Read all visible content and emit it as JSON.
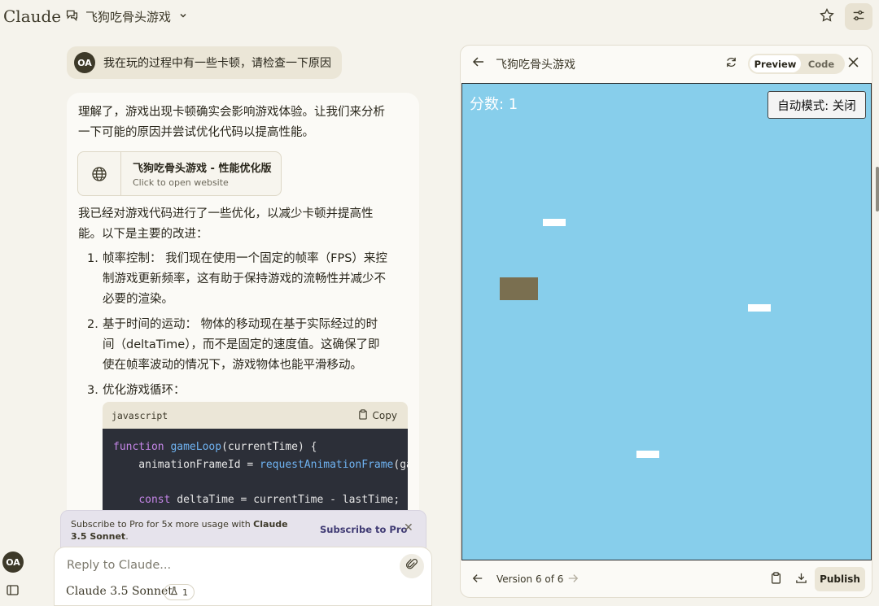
{
  "app": {
    "brand": "Claude"
  },
  "header": {
    "chat_title": "飞狗吃骨头游戏"
  },
  "user_message": {
    "avatar": "OA",
    "text": "我在玩的过程中有一些卡顿，请检查一下原因"
  },
  "assistant": {
    "intro": "理解了，游戏出现卡顿确实会影响游戏体验。让我们来分析一下可能的原因并尝试优化代码以提高性能。",
    "artifact_card": {
      "title": "飞狗吃骨头游戏 - 性能优化版",
      "subtitle": "Click to open website",
      "icon": "globe-icon"
    },
    "lead": "我已经对游戏代码进行了一些优化，以减少卡顿并提高性能。以下是主要的改进：",
    "list": [
      {
        "num": "1.",
        "text": "帧率控制： 我们现在使用一个固定的帧率（FPS）来控制游戏更新频率，这有助于保持游戏的流畅性并减少不必要的渲染。"
      },
      {
        "num": "2.",
        "text": "基于时间的运动： 物体的移动现在基于实际经过的时间（deltaTime），而不是固定的速度值。这确保了即使在帧率波动的情况下，游戏物体也能平滑移动。"
      },
      {
        "num": "3.",
        "text": "优化游戏循环："
      }
    ],
    "code": {
      "language": "javascript",
      "copy_label": "Copy",
      "lines": [
        {
          "parts": [
            [
              "kw",
              "function "
            ],
            [
              "fn",
              "gameLoop"
            ],
            [
              "",
              "(currentTime) {"
            ]
          ]
        },
        {
          "parts": [
            [
              "",
              "    animationFrameId = "
            ],
            [
              "fn",
              "requestAnimationFrame"
            ],
            [
              "",
              "(gam"
            ]
          ]
        },
        {
          "parts": [
            [
              "",
              ""
            ]
          ]
        },
        {
          "parts": [
            [
              "",
              "    "
            ],
            [
              "kw",
              "const"
            ],
            [
              "",
              " deltaTime = currentTime - lastTime;"
            ]
          ]
        }
      ]
    }
  },
  "promo": {
    "text_pre": "Subscribe to Pro for 5x more usage with ",
    "text_bold": "Claude 3.5 Sonnet",
    "text_post": ".",
    "cta": "Subscribe to Pro"
  },
  "composer": {
    "placeholder": "Reply to Claude...",
    "model": "Claude 3.5 Sonnet",
    "badge_count": "1"
  },
  "sidebar": {
    "avatar": "OA"
  },
  "panel": {
    "title": "飞狗吃骨头游戏",
    "tabs": {
      "preview": "Preview",
      "code": "Code"
    },
    "game": {
      "score_label": "分数: 1",
      "auto_button": "自动模式: 关闭"
    },
    "version_label": "Version 6 of 6",
    "publish": "Publish"
  }
}
